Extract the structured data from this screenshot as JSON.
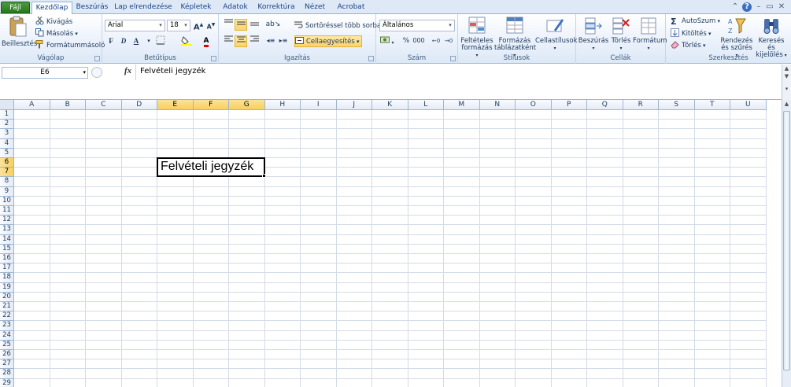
{
  "tabs": [
    "Fájl",
    "Kezdőlap",
    "Beszúrás",
    "Lap elrendezése",
    "Képletek",
    "Adatok",
    "Korrektúra",
    "Nézet",
    "Acrobat"
  ],
  "window_controls": {
    "minimize": "⌃",
    "help": "?",
    "restore": "–",
    "max": "▭",
    "close": "✕"
  },
  "clipboard": {
    "title": "Vágólap",
    "paste": "Beillesztés",
    "cut": "Kivágás",
    "copy": "Másolás",
    "format_painter": "Formátummásoló"
  },
  "font": {
    "title": "Betűtípus",
    "name": "Arial",
    "size": "18",
    "bold": "F",
    "italic": "D",
    "underline": "A",
    "grow": "A",
    "shrink": "A",
    "color_letter": "A"
  },
  "alignment": {
    "title": "Igazítás",
    "wrap": "Sortöréssel több sorba",
    "merge": "Cellaegyesítés"
  },
  "number": {
    "title": "Szám",
    "format": "Általános",
    "percent": "%",
    "thousands": "000"
  },
  "styles": {
    "title": "Stílusok",
    "conditional_1": "Feltételes",
    "conditional_2": "formázás",
    "table_1": "Formázás",
    "table_2": "táblázatként",
    "cell_styles": "Cellastílusok"
  },
  "cells": {
    "title": "Cellák",
    "insert": "Beszúrás",
    "delete": "Törlés",
    "format": "Formátum"
  },
  "editing": {
    "title": "Szerkesztés",
    "autosum": "AutoSzum",
    "fill": "Kitöltés",
    "clear": "Törlés",
    "sort_1": "Rendezés",
    "sort_2": "és szűrés",
    "find_1": "Keresés és",
    "find_2": "kijelölés"
  },
  "formula_bar": {
    "name_box": "E6",
    "fx": "fx",
    "content": "Felvételi jegyzék"
  },
  "sheet": {
    "columns": [
      "A",
      "B",
      "C",
      "D",
      "E",
      "F",
      "G",
      "H",
      "I",
      "J",
      "K",
      "L",
      "M",
      "N",
      "O",
      "P",
      "Q",
      "R",
      "S",
      "T",
      "U"
    ],
    "rows": [
      "1",
      "2",
      "3",
      "4",
      "5",
      "6",
      "7",
      "8",
      "9",
      "10",
      "11",
      "12",
      "13",
      "14",
      "15",
      "16",
      "17",
      "18",
      "19",
      "20",
      "21",
      "22",
      "23",
      "24",
      "25",
      "26",
      "27",
      "28",
      "29"
    ],
    "selected_columns": [
      "E",
      "F",
      "G"
    ],
    "selected_rows": [
      "6",
      "7"
    ],
    "active_cell_text": "Felvételi jegyzék"
  },
  "colors": {
    "file_tab": "#267a1b",
    "highlight": "#fbd36b",
    "ribbon_text": "#1e395b"
  }
}
